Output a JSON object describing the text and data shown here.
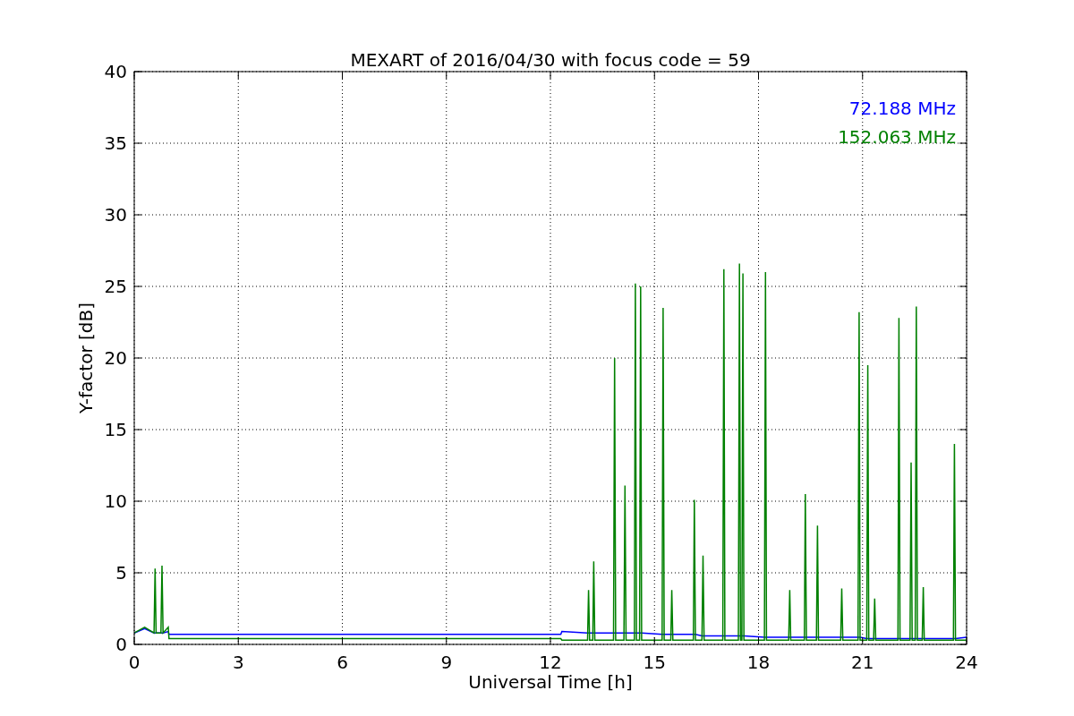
{
  "chart_data": {
    "type": "line",
    "title": "MEXART of 2016/04/30 with focus code = 59",
    "xlabel": "Universal Time [h]",
    "ylabel": "Y-factor [dB]",
    "xlim": [
      0,
      24
    ],
    "ylim": [
      0,
      40
    ],
    "xticks": [
      0,
      3,
      6,
      9,
      12,
      15,
      18,
      21,
      24
    ],
    "yticks": [
      0,
      5,
      10,
      15,
      20,
      25,
      30,
      35,
      40
    ],
    "grid": true,
    "x": [
      0,
      0.3,
      0.57,
      0.6,
      0.63,
      0.77,
      0.8,
      0.83,
      0.98,
      1.0,
      12.3,
      12.33,
      13.07,
      13.1,
      13.13,
      13.22,
      13.25,
      13.28,
      13.82,
      13.85,
      13.88,
      14.12,
      14.15,
      14.18,
      14.42,
      14.45,
      14.48,
      14.57,
      14.6,
      14.63,
      15.22,
      15.25,
      15.28,
      15.47,
      15.5,
      15.53,
      16.12,
      16.15,
      16.18,
      16.37,
      16.4,
      16.43,
      16.97,
      17.0,
      17.03,
      17.42,
      17.45,
      17.48,
      17.52,
      17.55,
      17.58,
      18.17,
      18.2,
      18.23,
      18.87,
      18.9,
      18.93,
      19.32,
      19.35,
      19.38,
      19.67,
      19.7,
      19.73,
      20.37,
      20.4,
      20.43,
      20.87,
      20.9,
      20.93,
      21.12,
      21.15,
      21.18,
      21.32,
      21.35,
      21.38,
      22.02,
      22.05,
      22.08,
      22.37,
      22.4,
      22.43,
      22.52,
      22.55,
      22.58,
      22.72,
      22.75,
      22.78,
      23.62,
      23.65,
      23.68,
      24
    ],
    "series": [
      {
        "name": "72.188 MHz",
        "color": "#0000ff",
        "values": [
          0.8,
          1.1,
          0.8,
          0.8,
          0.8,
          0.8,
          0.8,
          0.8,
          0.9,
          0.7,
          0.7,
          0.9,
          0.8,
          0.8,
          0.8,
          0.8,
          0.8,
          0.8,
          0.8,
          0.8,
          0.8,
          0.8,
          0.8,
          0.8,
          0.8,
          0.8,
          0.8,
          0.8,
          0.8,
          0.8,
          0.7,
          0.7,
          0.7,
          0.7,
          0.7,
          0.7,
          0.7,
          0.7,
          0.7,
          0.6,
          0.6,
          0.6,
          0.6,
          0.6,
          0.6,
          0.6,
          0.6,
          0.6,
          0.6,
          0.6,
          0.6,
          0.5,
          0.5,
          0.5,
          0.5,
          0.5,
          0.5,
          0.5,
          0.5,
          0.5,
          0.5,
          0.5,
          0.5,
          0.5,
          0.5,
          0.5,
          0.5,
          0.5,
          0.5,
          0.4,
          0.4,
          0.4,
          0.4,
          0.4,
          0.4,
          0.4,
          0.4,
          0.4,
          0.4,
          0.4,
          0.4,
          0.4,
          0.4,
          0.4,
          0.4,
          0.4,
          0.4,
          0.4,
          0.4,
          0.4,
          0.5
        ]
      },
      {
        "name": "152.063 MHz",
        "color": "#008000",
        "values": [
          0.8,
          1.2,
          0.8,
          5.3,
          0.8,
          0.8,
          5.5,
          0.8,
          1.2,
          0.4,
          0.4,
          0.3,
          0.3,
          3.8,
          0.3,
          0.3,
          5.8,
          0.3,
          0.3,
          20,
          0.3,
          0.3,
          11.1,
          0.3,
          0.3,
          25.2,
          0.3,
          0.3,
          25,
          0.3,
          0.3,
          23.5,
          0.3,
          0.3,
          3.8,
          0.3,
          0.3,
          10.1,
          0.3,
          0.3,
          6.2,
          0.3,
          0.3,
          26.2,
          0.3,
          0.3,
          26.6,
          0.3,
          0.3,
          25.9,
          0.3,
          0.3,
          26,
          0.3,
          0.3,
          3.8,
          0.3,
          0.3,
          10.5,
          0.3,
          0.3,
          8.3,
          0.3,
          0.3,
          3.9,
          0.3,
          0.3,
          23.2,
          0.3,
          0.3,
          19.5,
          0.3,
          0.3,
          3.2,
          0.3,
          0.3,
          22.8,
          0.3,
          0.3,
          12.7,
          0.3,
          0.3,
          23.6,
          0.3,
          0.3,
          4,
          0.3,
          0.3,
          14,
          0.3,
          0.3
        ]
      }
    ]
  }
}
